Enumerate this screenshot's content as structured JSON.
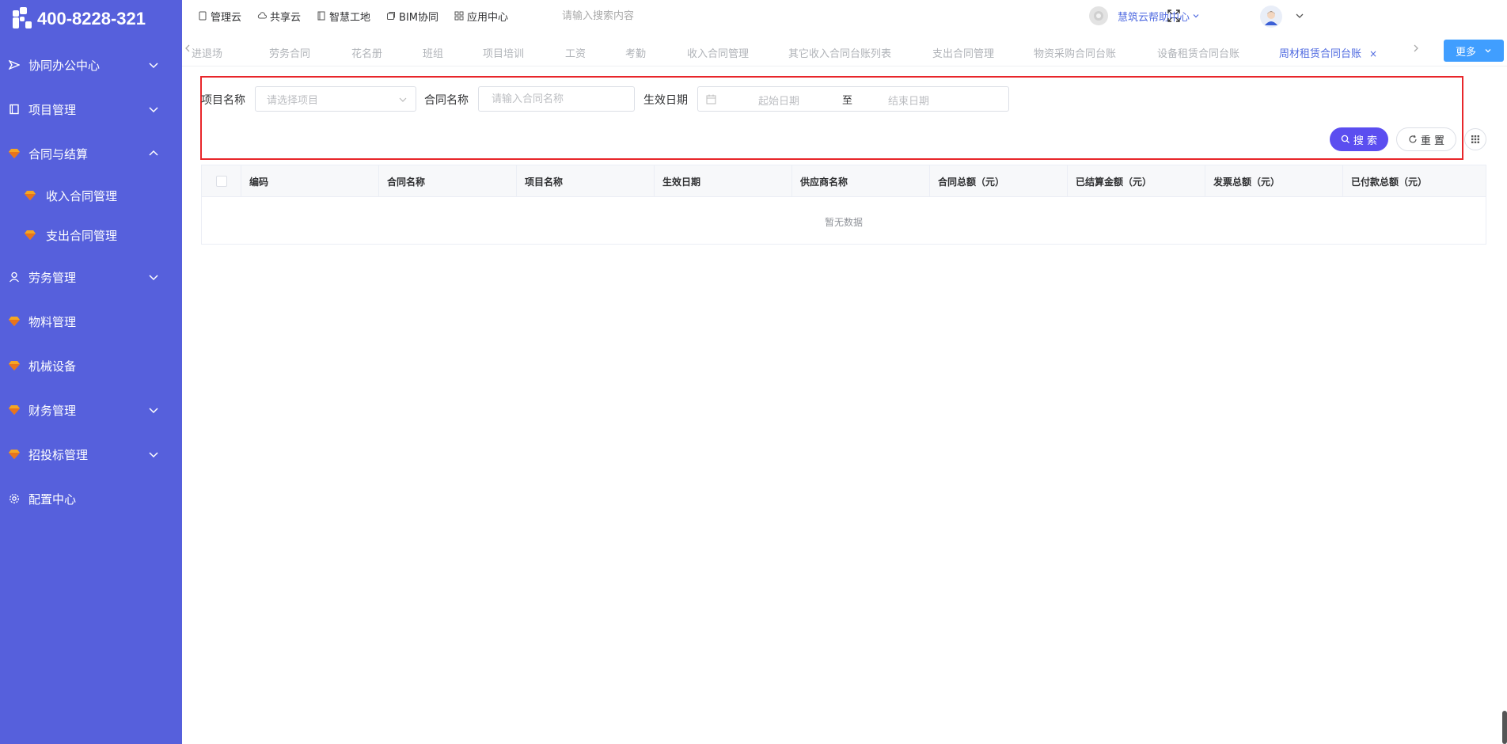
{
  "sidebar": {
    "logo_text": "400-8228-321",
    "items": [
      {
        "label": "协同办公中心",
        "icon": "send-icon",
        "expanded": false
      },
      {
        "label": "项目管理",
        "icon": "book-icon",
        "expanded": false
      },
      {
        "label": "合同与结算",
        "icon": "gem-icon",
        "expanded": true
      },
      {
        "label": "劳务管理",
        "icon": "worker-icon",
        "expanded": false
      },
      {
        "label": "物料管理",
        "icon": "gem-icon"
      },
      {
        "label": "机械设备",
        "icon": "gem-icon"
      },
      {
        "label": "财务管理",
        "icon": "gem-icon",
        "expanded": false
      },
      {
        "label": "招投标管理",
        "icon": "gem-icon",
        "expanded": false
      },
      {
        "label": "配置中心",
        "icon": "gear-icon"
      }
    ],
    "sub_items": [
      {
        "label": "收入合同管理",
        "icon": "gem-icon"
      },
      {
        "label": "支出合同管理",
        "icon": "gem-icon"
      }
    ]
  },
  "topbar": {
    "nav": [
      {
        "label": "管理云",
        "icon": "doc-icon"
      },
      {
        "label": "共享云",
        "icon": "cloud-icon"
      },
      {
        "label": "智慧工地",
        "icon": "book-icon"
      },
      {
        "label": "BIM协同",
        "icon": "cube-icon"
      },
      {
        "label": "应用中心",
        "icon": "grid-icon"
      }
    ],
    "search_placeholder": "请输入搜索内容",
    "help_label": "慧筑云帮助中心"
  },
  "tabs": {
    "items": [
      {
        "label": "进退场"
      },
      {
        "label": "劳务合同"
      },
      {
        "label": "花名册"
      },
      {
        "label": "班组"
      },
      {
        "label": "项目培训"
      },
      {
        "label": "工资"
      },
      {
        "label": "考勤"
      },
      {
        "label": "收入合同管理"
      },
      {
        "label": "其它收入合同台账列表"
      },
      {
        "label": "支出合同管理"
      },
      {
        "label": "物资采购合同台账"
      },
      {
        "label": "设备租赁合同台账"
      },
      {
        "label": "周材租赁合同台账",
        "active": true
      }
    ],
    "close_glyph": "×",
    "more_label": "更多"
  },
  "filters": {
    "project_label": "项目名称",
    "project_placeholder": "请选择项目",
    "contract_label": "合同名称",
    "contract_placeholder": "请输入合同名称",
    "date_label": "生效日期",
    "date_start_placeholder": "起始日期",
    "date_separator": "至",
    "date_end_placeholder": "结束日期",
    "search_button": "搜 索",
    "reset_button": "重 置"
  },
  "table": {
    "columns": [
      "编码",
      "合同名称",
      "项目名称",
      "生效日期",
      "供应商名称",
      "合同总额（元）",
      "已结算金额（元）",
      "发票总额（元）",
      "已付款总额（元）"
    ],
    "empty_text": "暂无数据"
  },
  "colors": {
    "sidebar_bg": "#5660dc",
    "accent": "#4f6ae0",
    "search_button": "#5b4ef0",
    "more_button": "#409eff",
    "highlight_border": "#e8262a"
  }
}
